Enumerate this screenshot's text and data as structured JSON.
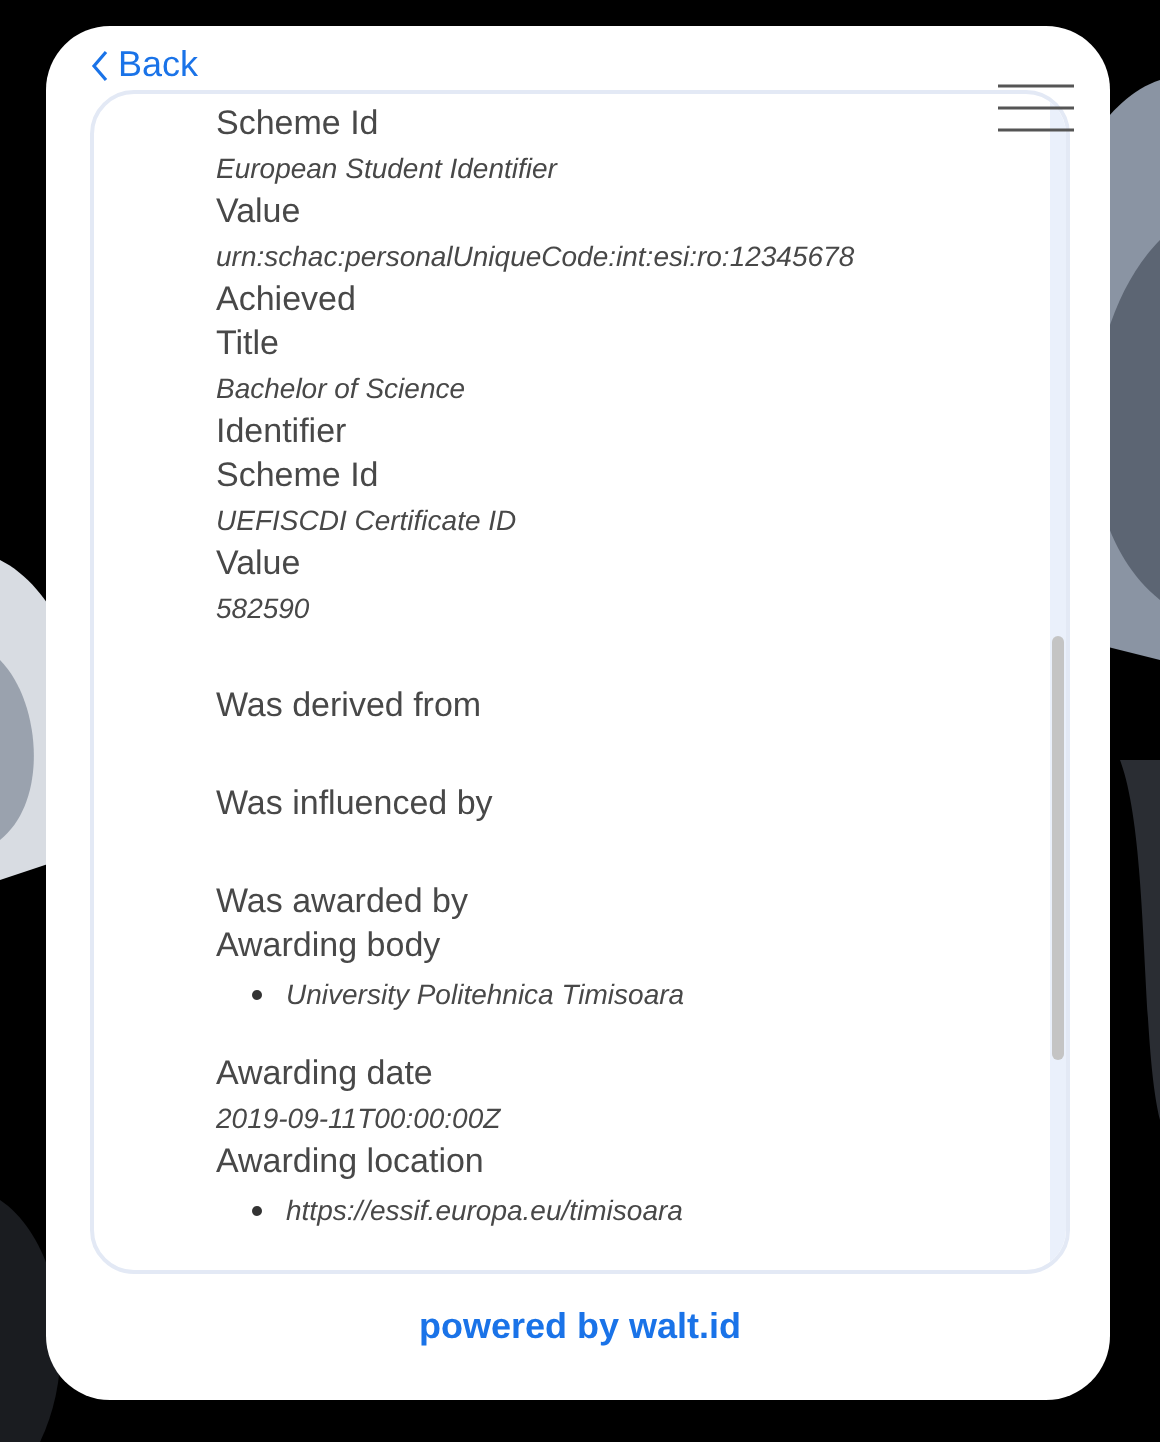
{
  "header": {
    "back": "Back"
  },
  "details": [
    {
      "kind": "label",
      "text": "Scheme Id"
    },
    {
      "kind": "value",
      "text": "European Student Identifier"
    },
    {
      "kind": "label",
      "text": "Value"
    },
    {
      "kind": "value",
      "text": "urn:schac:personalUniqueCode:int:esi:ro:12345678"
    },
    {
      "kind": "label",
      "text": "Achieved"
    },
    {
      "kind": "label",
      "text": "Title"
    },
    {
      "kind": "value",
      "text": "Bachelor of Science"
    },
    {
      "kind": "label",
      "text": "Identifier"
    },
    {
      "kind": "label",
      "text": "Scheme Id"
    },
    {
      "kind": "value",
      "text": "UEFISCDI Certificate ID"
    },
    {
      "kind": "label",
      "text": "Value"
    },
    {
      "kind": "value",
      "text": "582590"
    },
    {
      "kind": "section",
      "text": "Was derived from"
    },
    {
      "kind": "section",
      "text": "Was influenced by"
    },
    {
      "kind": "section",
      "text": "Was awarded by"
    },
    {
      "kind": "label",
      "text": "Awarding body"
    },
    {
      "kind": "bullet",
      "text": "University Politehnica Timisoara"
    },
    {
      "kind": "label",
      "text": "Awarding date"
    },
    {
      "kind": "value",
      "text": "2019-09-11T00:00:00Z"
    },
    {
      "kind": "label",
      "text": "Awarding location"
    },
    {
      "kind": "bullet",
      "text": "https://essif.europa.eu/timisoara"
    }
  ],
  "footer": "powered by walt.id"
}
